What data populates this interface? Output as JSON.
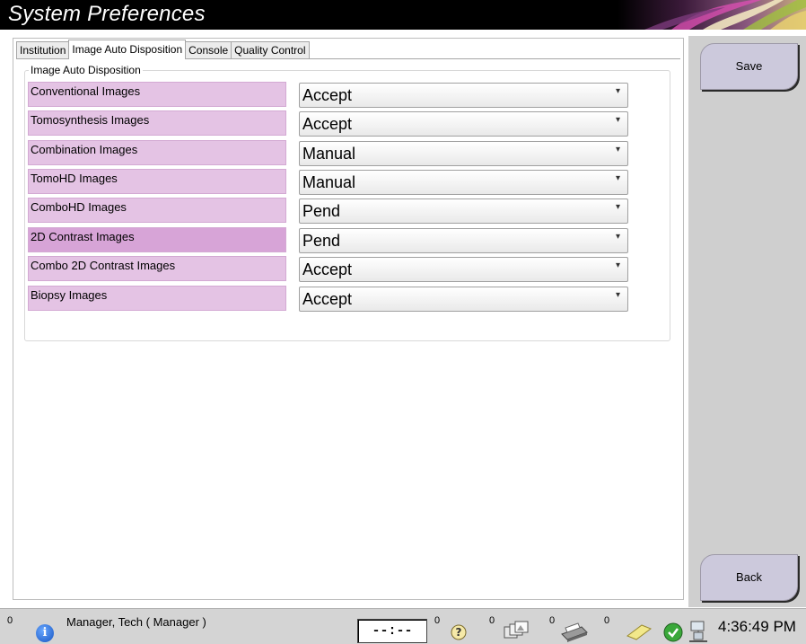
{
  "window": {
    "title": "System Preferences"
  },
  "tabs": [
    {
      "label": "Institution",
      "active": false
    },
    {
      "label": "Image Auto Disposition",
      "active": true
    },
    {
      "label": "Console",
      "active": false
    },
    {
      "label": "Quality Control",
      "active": false
    }
  ],
  "group": {
    "label": "Image Auto Disposition",
    "rows": [
      {
        "label": "Conventional Images",
        "value": "Accept"
      },
      {
        "label": "Tomosynthesis Images",
        "value": "Accept"
      },
      {
        "label": "Combination Images",
        "value": "Manual"
      },
      {
        "label": "TomoHD Images",
        "value": "Manual"
      },
      {
        "label": "ComboHD Images",
        "value": "Pend"
      },
      {
        "label": "2D Contrast Images",
        "value": "Pend"
      },
      {
        "label": "Combo 2D Contrast Images",
        "value": "Accept"
      },
      {
        "label": "Biopsy Images",
        "value": "Accept"
      }
    ]
  },
  "buttons": {
    "save": "Save",
    "back": "Back"
  },
  "statusbar": {
    "alert_count": "0",
    "user": "Manager, Tech ( Manager )",
    "timer": "--:--",
    "counts": [
      "0",
      "0",
      "0",
      "0"
    ],
    "time": "4:36:49 PM"
  },
  "icons": {
    "info": "info-icon",
    "help": "question-icon",
    "images": "image-stack-icon",
    "print": "printer-icon",
    "notes": "note-icon",
    "ok": "check-icon",
    "network": "network-icon"
  },
  "colors": {
    "row_label_bg": "#e4c3e4",
    "row_label_highlight": "#d7a4d7",
    "button_bg": "#ccc9dc",
    "panel_bg": "#cfcfcf"
  }
}
